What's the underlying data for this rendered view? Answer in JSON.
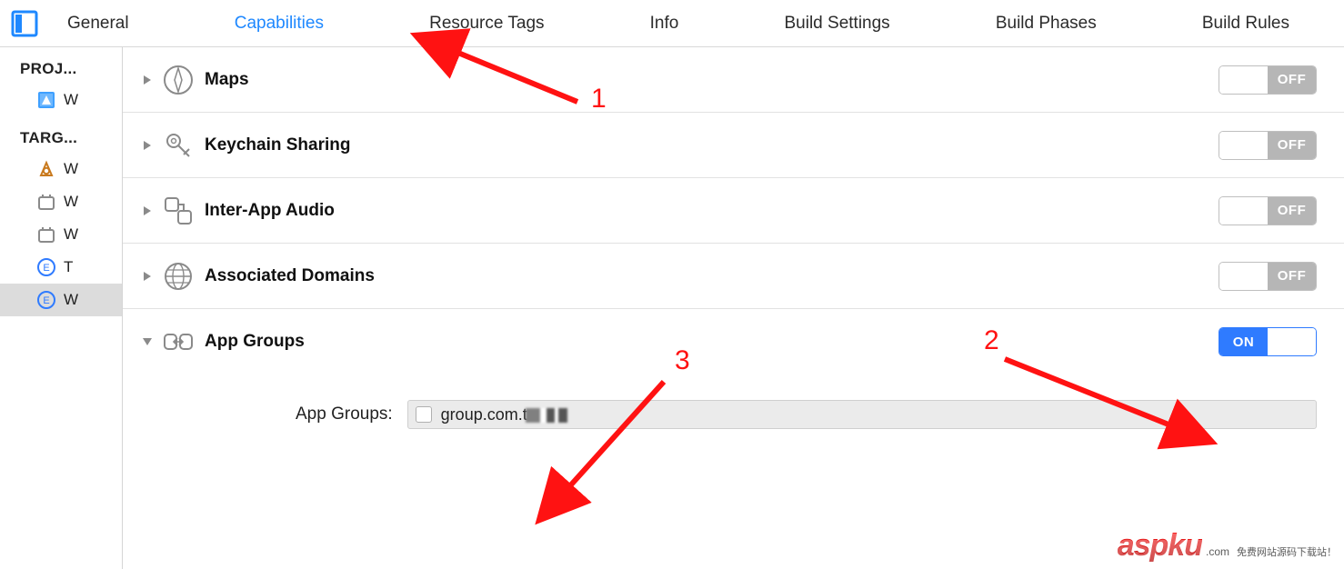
{
  "tabs": {
    "items": [
      "General",
      "Capabilities",
      "Resource Tags",
      "Info",
      "Build Settings",
      "Build Phases",
      "Build Rules"
    ],
    "selected_index": 1
  },
  "sidebar": {
    "project_heading": "PROJ...",
    "targets_heading": "TARG...",
    "project_items": [
      {
        "label": "W",
        "icon": "project"
      }
    ],
    "target_items": [
      {
        "label": "W",
        "icon": "app"
      },
      {
        "label": "W",
        "icon": "extension"
      },
      {
        "label": "W",
        "icon": "extension"
      },
      {
        "label": "T",
        "icon": "e-badge"
      },
      {
        "label": "W",
        "icon": "e-badge",
        "selected": true
      }
    ]
  },
  "capabilities": [
    {
      "id": "maps",
      "title": "Maps",
      "on": false,
      "expanded": false,
      "icon": "compass"
    },
    {
      "id": "keychain",
      "title": "Keychain Sharing",
      "on": false,
      "expanded": false,
      "icon": "key"
    },
    {
      "id": "iaa",
      "title": "Inter-App Audio",
      "on": false,
      "expanded": false,
      "icon": "audio"
    },
    {
      "id": "assoc",
      "title": "Associated Domains",
      "on": false,
      "expanded": false,
      "icon": "globe"
    },
    {
      "id": "appgroups",
      "title": "App Groups",
      "on": true,
      "expanded": true,
      "icon": "appgroups"
    }
  ],
  "app_groups": {
    "field_label": "App Groups:",
    "items": [
      {
        "checked": false,
        "value": "group.com.t",
        "value_obscured_suffix": true
      }
    ]
  },
  "toggle_labels": {
    "on": "ON",
    "off": "OFF"
  },
  "annotations": {
    "labels": [
      "1",
      "2",
      "3"
    ]
  },
  "watermark": {
    "brand": "aspku",
    "tld": ".com",
    "tagline": "免费网站源码下载站！"
  }
}
